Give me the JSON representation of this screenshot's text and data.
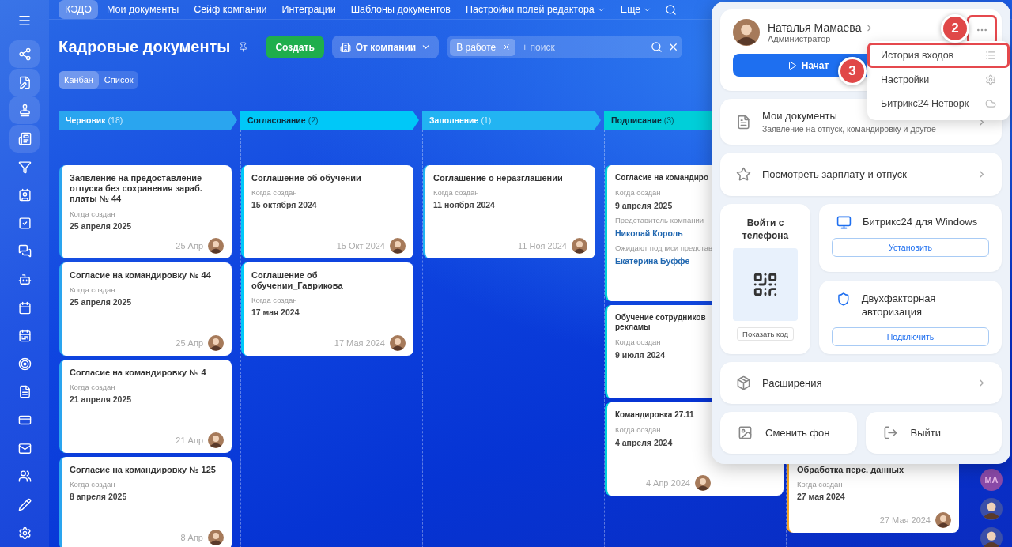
{
  "nav": {
    "tabs": [
      {
        "label": "КЭДО",
        "selected": true,
        "dropdown": false
      },
      {
        "label": "Мои документы",
        "selected": false,
        "dropdown": false
      },
      {
        "label": "Сейф компании",
        "selected": false,
        "dropdown": false
      },
      {
        "label": "Интеграции",
        "selected": false,
        "dropdown": false
      },
      {
        "label": "Шаблоны документов",
        "selected": false,
        "dropdown": false
      },
      {
        "label": "Настройки полей редактора",
        "selected": false,
        "dropdown": true
      },
      {
        "label": "Еще",
        "selected": false,
        "dropdown": true
      }
    ]
  },
  "header": {
    "title": "Кадровые документы",
    "create_button": "Создать",
    "filter_button": "От компании",
    "search": {
      "chips": [
        {
          "label": "В работе"
        }
      ],
      "placeholder": "+ поиск"
    }
  },
  "view_switch": [
    {
      "label": "Канбан",
      "selected": true
    },
    {
      "label": "Список",
      "selected": false
    }
  ],
  "columns": [
    {
      "title": "Черновик",
      "count": "(18)",
      "color": "#2aa5ef",
      "cards": [
        {
          "title": "Заявление на предоставление отпуска без сохранения зараб. платы № 44",
          "fields": [
            {
              "label": "Когда создан",
              "value": "25 апреля 2025",
              "kind": "text"
            }
          ],
          "footer_date": "25 Апр"
        },
        {
          "title": "Согласие на командировку № 44",
          "fields": [
            {
              "label": "Когда создан",
              "value": "25 апреля 2025",
              "kind": "text"
            }
          ],
          "footer_date": "25 Апр"
        },
        {
          "title": "Согласие на командировку № 4",
          "fields": [
            {
              "label": "Когда создан",
              "value": "21 апреля 2025",
              "kind": "text"
            }
          ],
          "footer_date": "21 Апр"
        },
        {
          "title": "Согласие на командировку № 125",
          "fields": [
            {
              "label": "Когда создан",
              "value": "8 апреля 2025",
              "kind": "text"
            }
          ],
          "footer_date": "8 Апр"
        }
      ]
    },
    {
      "title": "Согласование",
      "count": "(2)",
      "color": "#00c8f8",
      "cards": [
        {
          "title": "Соглашение об обучении",
          "fields": [
            {
              "label": "Когда создан",
              "value": "15 октября 2024",
              "kind": "text"
            }
          ],
          "footer_date": "15 Окт 2024"
        },
        {
          "title": "Соглашение об обучении_Гаврикова",
          "fields": [
            {
              "label": "Когда создан",
              "value": "17 мая 2024",
              "kind": "text"
            }
          ],
          "footer_date": "17 Мая 2024"
        }
      ]
    },
    {
      "title": "Заполнение",
      "count": "(1)",
      "color": "#22b4f2",
      "cards": [
        {
          "title": "Соглашение о неразглашении",
          "fields": [
            {
              "label": "Когда создан",
              "value": "11 ноября 2024",
              "kind": "text"
            }
          ],
          "footer_date": "11 Ноя 2024"
        }
      ]
    },
    {
      "title": "Подписание",
      "count": "(3)",
      "color": "#00cfd9",
      "cards": [
        {
          "title": "Согласие на командиро",
          "fields": [
            {
              "label": "Когда создан",
              "value": "9 апреля 2025",
              "kind": "text"
            },
            {
              "label": "Представитель компании",
              "value": "Николай Король",
              "kind": "person"
            },
            {
              "label": "Ожидают подписи представ",
              "value": "Екатерина Буффе",
              "kind": "person"
            }
          ]
        },
        {
          "title": "Обучение сотрудников рекламы",
          "fields": [
            {
              "label": "Когда создан",
              "value": "9 июля 2024",
              "kind": "text"
            }
          ]
        },
        {
          "title": "Командировка 27.11",
          "fields": [
            {
              "label": "Когда создан",
              "value": "4 апреля 2024",
              "kind": "text"
            }
          ],
          "footer_date": "4 Апр 2024"
        }
      ]
    },
    {
      "color": "#f5a623",
      "cards": [
        {
          "title": "Обработка перс. данных",
          "fields": [
            {
              "label": "Когда создан",
              "value": "27 мая 2024",
              "kind": "text"
            }
          ],
          "footer_date": "27 Мая 2024"
        }
      ]
    }
  ],
  "avatars": [
    {
      "kind": "initials",
      "text": "МА"
    },
    {
      "kind": "picture"
    },
    {
      "kind": "picture"
    }
  ],
  "profile_panel": {
    "user": {
      "name": "Наталья Мамаева",
      "role": "Администратор",
      "start_button": "Начат",
      "more_outlined": true
    },
    "menu": [
      {
        "label": "История входов",
        "outlined": true
      },
      {
        "label": "Настройки",
        "outlined": false
      },
      {
        "label": "Битрикс24 Нетворк",
        "outlined": false
      }
    ],
    "links": [
      {
        "title": "Мои документы",
        "subtitle": "Заявление на отпуск, командировку и другое"
      },
      {
        "title": "Посмотреть зарплату и отпуск"
      }
    ],
    "phone_login": {
      "title": "Войти с телефона",
      "button": "Показать код"
    },
    "apps": [
      {
        "title": "Битрикс24 для Windows",
        "button": "Установить"
      },
      {
        "title": "Двухфакторная авторизация",
        "button": "Подключить"
      }
    ],
    "extensions": {
      "title": "Расширения"
    },
    "actions": [
      {
        "label": "Сменить фон"
      },
      {
        "label": "Выйти"
      }
    ]
  },
  "annotations": [
    {
      "number": "2"
    },
    {
      "number": "3"
    }
  ]
}
